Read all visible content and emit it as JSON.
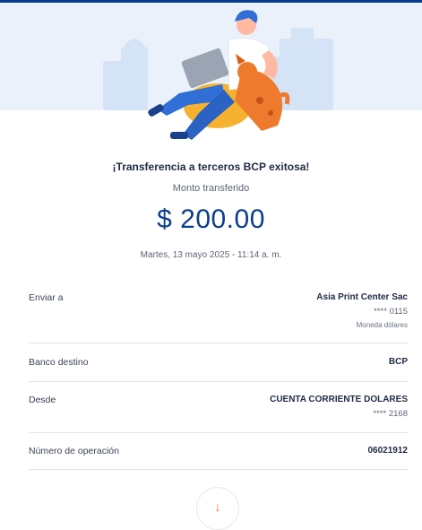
{
  "receipt": {
    "title": "¡Transferencia a terceros BCP exitosa!",
    "amount_label": "Monto transferido",
    "amount": "$ 200.00",
    "datetime": "Martes, 13 mayo 2025 - 11:14 a. m."
  },
  "details": {
    "recipient": {
      "label": "Enviar a",
      "name": "Asia Print Center Sac",
      "account": "**** 0115",
      "currency": "Moneda dólares"
    },
    "bank": {
      "label": "Banco destino",
      "value": "BCP"
    },
    "from": {
      "label": "Desde",
      "account_name": "CUENTA CORRIENTE DOLARES",
      "account": "**** 2168"
    },
    "operation": {
      "label": "Número de operación",
      "value": "06021912"
    }
  },
  "colors": {
    "brand_blue": "#0a3d8f",
    "accent_orange": "#ff6a13",
    "hero_bg": "#eaf1fb"
  },
  "icons": {
    "bottom_action": "download-arrow-icon"
  }
}
